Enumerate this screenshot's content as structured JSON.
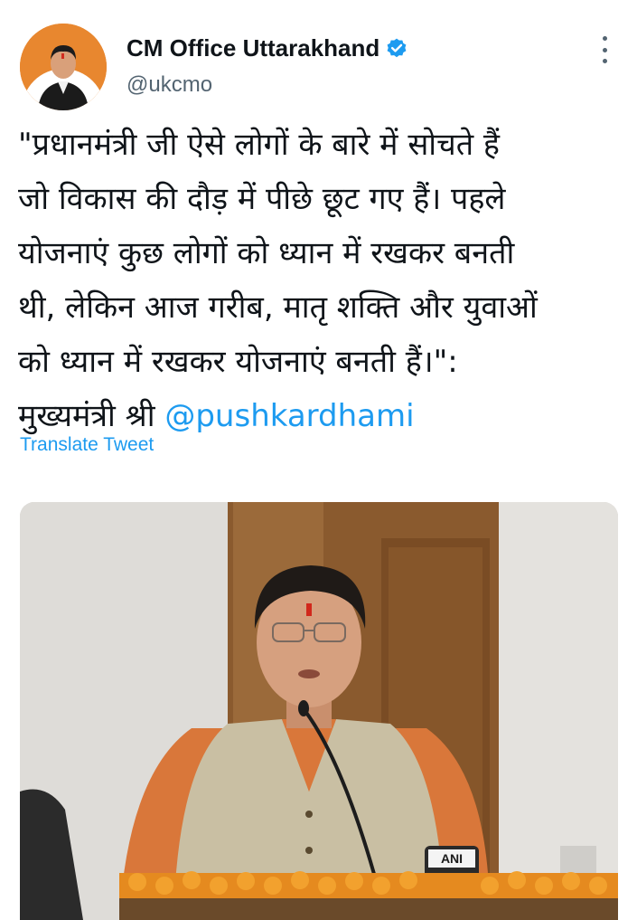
{
  "account": {
    "display_name": "CM Office Uttarakhand",
    "handle": "@ukcmo",
    "verified": true,
    "verified_icon": "verified-badge-icon",
    "avatar_icon": "avatar"
  },
  "menu": {
    "icon": "more-options-icon"
  },
  "tweet": {
    "lines": [
      "\"प्रधानमंत्री जी ऐसे लोगों के बारे में सोचते हैं",
      "जो विकास की दौड़ में पीछे छूट गए हैं। पहले",
      "योजनाएं कुछ लोगों को ध्यान में रखकर बनती",
      "थी, लेकिन आज गरीब, मातृ शक्ति और युवाओं",
      "को ध्यान में रखकर योजनाएं बनती हैं।\":"
    ],
    "last_line_prefix": "मुख्यमंत्री श्री ",
    "mention": "@pushkardhami",
    "translate_label": "Translate Tweet"
  },
  "media": {
    "type": "photo",
    "microphone_label": "ANI"
  },
  "colors": {
    "link": "#1d9bf0",
    "text": "#0f1419",
    "secondary": "#536471",
    "verified": "#1d9bf0"
  }
}
